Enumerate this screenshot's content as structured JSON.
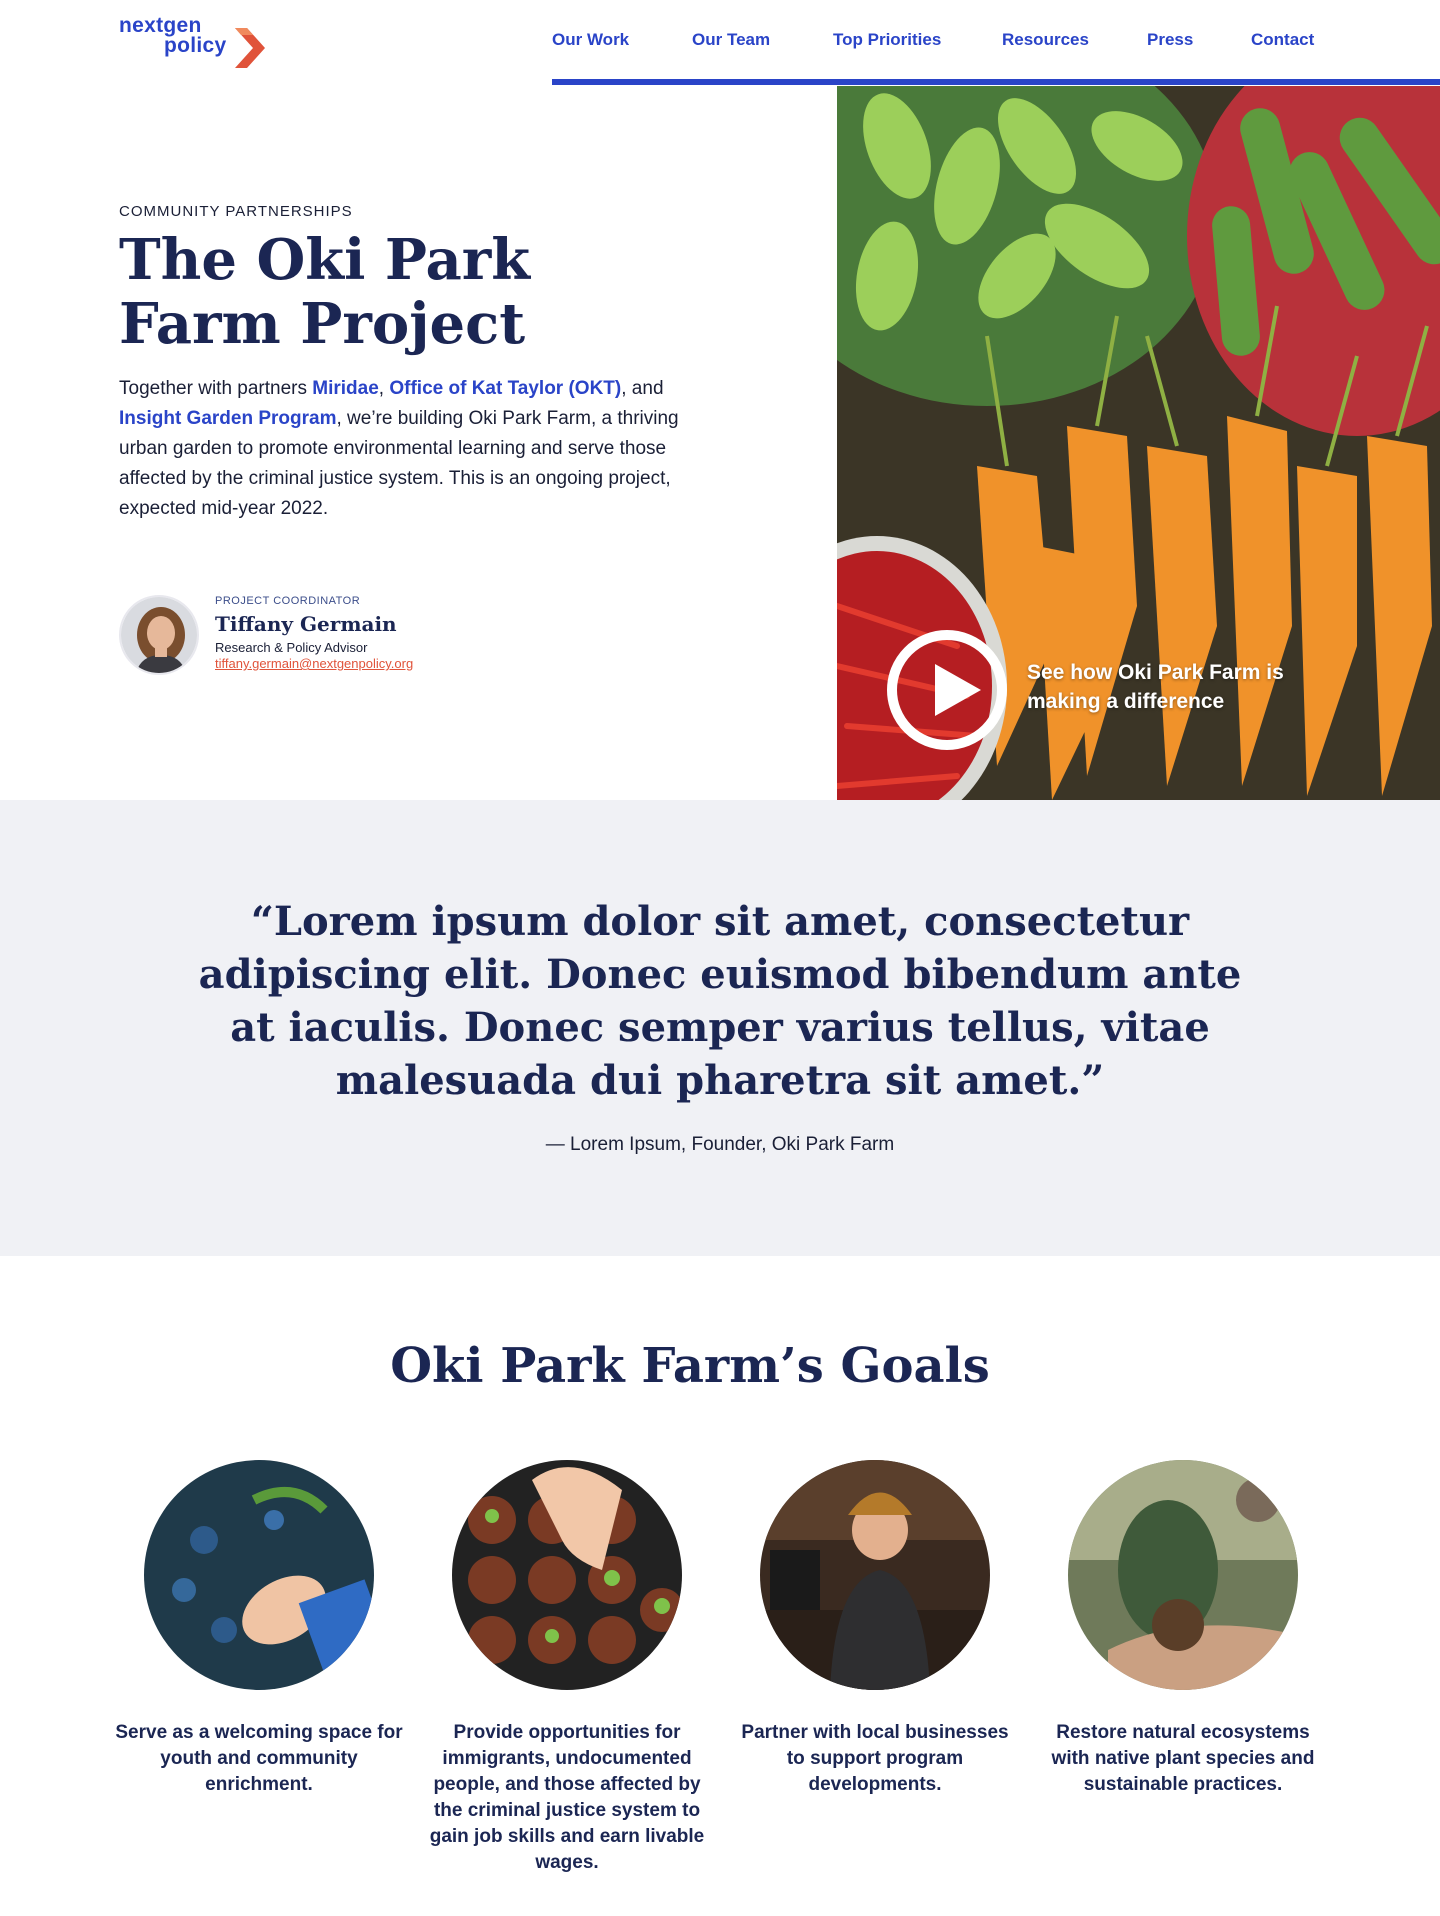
{
  "brand": {
    "line1": "nextgen",
    "line2": "policy"
  },
  "nav": {
    "items": [
      "Our Work",
      "Our Team",
      "Top Priorities",
      "Resources",
      "Press",
      "Contact"
    ]
  },
  "hero": {
    "eyebrow": "COMMUNITY PARTNERSHIPS",
    "title": "The Oki Park Farm Project",
    "copy_before": "Together with partners ",
    "partner1": "Miridae",
    "sep1": ", ",
    "partner2": "Office of Kat Taylor (OKT)",
    "sep2": ", and ",
    "partner3": "Insight Garden Program",
    "copy_after": ", we’re building Oki Park Farm, a thriving urban garden to promote environmental learning and serve those affected by the criminal justice system. This is an ongoing project, expected mid-year 2022.",
    "video_caption": "See how  Oki Park Farm is making a difference"
  },
  "coordinator": {
    "label": "PROJECT COORDINATOR",
    "name": "Tiffany Germain",
    "role": "Research & Policy Advisor",
    "email": "tiffany.germain@nextgenpolicy.org"
  },
  "quote": {
    "text": "“Lorem ipsum dolor sit amet, consectetur adipiscing elit. Donec euismod bibendum ante at iaculis. Donec semper varius tellus, vitae malesuada dui pharetra sit amet.”",
    "attribution": "— Lorem Ipsum, Founder, Oki Park Farm"
  },
  "goals": {
    "title": "Oki Park Farm’s Goals",
    "items": [
      "Serve as a welcoming space for youth and community enrichment.",
      "Provide opportunities for immigrants, undocumented people, and those affected by the criminal justice system to gain job skills and earn livable wages.",
      "Partner with local businesses to support program developments.",
      "Restore natural ecosystems with native plant species and sustainable practices."
    ]
  },
  "colors": {
    "brand_blue": "#2a44c8",
    "navy": "#1b2653",
    "accent_red": "#e0533a",
    "quote_bg": "#f0f1f5"
  }
}
